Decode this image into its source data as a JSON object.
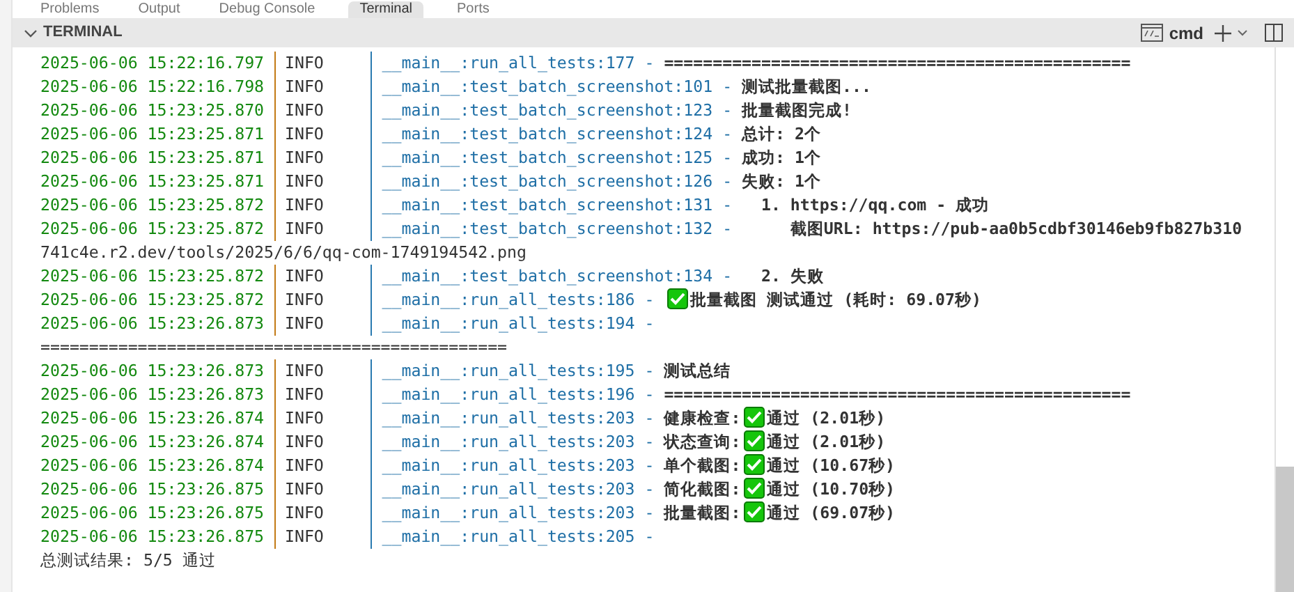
{
  "panel_tabs": [
    {
      "label": "Problems",
      "selected": false
    },
    {
      "label": "Output",
      "selected": false
    },
    {
      "label": "Debug Console",
      "selected": false
    },
    {
      "label": "Terminal",
      "selected": true
    },
    {
      "label": "Ports",
      "selected": false
    }
  ],
  "terminal": {
    "title": "TERMINAL",
    "shell": "cmd",
    "lines": [
      {
        "kind": "log",
        "time": "2025-06-06 15:22:16.797",
        "level": "INFO",
        "source": "__main__:run_all_tests:177 -",
        "segments": [
          {
            "kind": "text",
            "text": "================================================"
          }
        ]
      },
      {
        "kind": "log",
        "time": "2025-06-06 15:22:16.798",
        "level": "INFO",
        "source": "__main__:test_batch_screenshot:101 -",
        "segments": [
          {
            "kind": "text",
            "text": "测试批量截图..."
          }
        ]
      },
      {
        "kind": "log",
        "time": "2025-06-06 15:23:25.870",
        "level": "INFO",
        "source": "__main__:test_batch_screenshot:123 -",
        "segments": [
          {
            "kind": "text",
            "text": "批量截图完成!"
          }
        ]
      },
      {
        "kind": "log",
        "time": "2025-06-06 15:23:25.871",
        "level": "INFO",
        "source": "__main__:test_batch_screenshot:124 -",
        "segments": [
          {
            "kind": "text",
            "text": "总计: 2个"
          }
        ]
      },
      {
        "kind": "log",
        "time": "2025-06-06 15:23:25.871",
        "level": "INFO",
        "source": "__main__:test_batch_screenshot:125 -",
        "segments": [
          {
            "kind": "text",
            "text": "成功: 1个"
          }
        ]
      },
      {
        "kind": "log",
        "time": "2025-06-06 15:23:25.871",
        "level": "INFO",
        "source": "__main__:test_batch_screenshot:126 -",
        "segments": [
          {
            "kind": "text",
            "text": "失败: 1个"
          }
        ]
      },
      {
        "kind": "log",
        "time": "2025-06-06 15:23:25.872",
        "level": "INFO",
        "source": "__main__:test_batch_screenshot:131 -",
        "segments": [
          {
            "kind": "text",
            "text": "  1. https://qq.com - 成功"
          }
        ]
      },
      {
        "kind": "log",
        "time": "2025-06-06 15:23:25.872",
        "level": "INFO",
        "source": "__main__:test_batch_screenshot:132 -",
        "segments": [
          {
            "kind": "text",
            "text": "     截图URL: https://pub-aa0b5cdbf30146eb9fb827b310"
          }
        ]
      },
      {
        "kind": "plain",
        "text": "741c4e.r2.dev/tools/2025/6/6/qq-com-1749194542.png"
      },
      {
        "kind": "log",
        "time": "2025-06-06 15:23:25.872",
        "level": "INFO",
        "source": "__main__:test_batch_screenshot:134 -",
        "segments": [
          {
            "kind": "text",
            "text": "  2. 失败"
          }
        ]
      },
      {
        "kind": "log",
        "time": "2025-06-06 15:23:25.872",
        "level": "INFO",
        "source": "__main__:run_all_tests:186 -",
        "segments": [
          {
            "kind": "check"
          },
          {
            "kind": "text",
            "text": "批量截图 测试通过 (耗时: 69.07秒)"
          }
        ]
      },
      {
        "kind": "log",
        "time": "2025-06-06 15:23:26.873",
        "level": "INFO",
        "source": "__main__:run_all_tests:194 -"
      },
      {
        "kind": "plain",
        "text": "================================================"
      },
      {
        "kind": "log",
        "time": "2025-06-06 15:23:26.873",
        "level": "INFO",
        "source": "__main__:run_all_tests:195 -",
        "segments": [
          {
            "kind": "text",
            "text": "测试总结"
          }
        ]
      },
      {
        "kind": "log",
        "time": "2025-06-06 15:23:26.873",
        "level": "INFO",
        "source": "__main__:run_all_tests:196 -",
        "segments": [
          {
            "kind": "text",
            "text": "================================================"
          }
        ]
      },
      {
        "kind": "log",
        "time": "2025-06-06 15:23:26.874",
        "level": "INFO",
        "source": "__main__:run_all_tests:203 -",
        "segments": [
          {
            "kind": "text",
            "text": "健康检查:"
          },
          {
            "kind": "check"
          },
          {
            "kind": "text",
            "text": "通过 (2.01秒)"
          }
        ]
      },
      {
        "kind": "log",
        "time": "2025-06-06 15:23:26.874",
        "level": "INFO",
        "source": "__main__:run_all_tests:203 -",
        "segments": [
          {
            "kind": "text",
            "text": "状态查询:"
          },
          {
            "kind": "check"
          },
          {
            "kind": "text",
            "text": "通过 (2.01秒)"
          }
        ]
      },
      {
        "kind": "log",
        "time": "2025-06-06 15:23:26.874",
        "level": "INFO",
        "source": "__main__:run_all_tests:203 -",
        "segments": [
          {
            "kind": "text",
            "text": "单个截图:"
          },
          {
            "kind": "check"
          },
          {
            "kind": "text",
            "text": "通过 (10.67秒)"
          }
        ]
      },
      {
        "kind": "log",
        "time": "2025-06-06 15:23:26.875",
        "level": "INFO",
        "source": "__main__:run_all_tests:203 -",
        "segments": [
          {
            "kind": "text",
            "text": "简化截图:"
          },
          {
            "kind": "check"
          },
          {
            "kind": "text",
            "text": "通过 (10.70秒)"
          }
        ]
      },
      {
        "kind": "log",
        "time": "2025-06-06 15:23:26.875",
        "level": "INFO",
        "source": "__main__:run_all_tests:203 -",
        "segments": [
          {
            "kind": "text",
            "text": "批量截图:"
          },
          {
            "kind": "check"
          },
          {
            "kind": "text",
            "text": "通过 (69.07秒)"
          }
        ]
      },
      {
        "kind": "log",
        "time": "2025-06-06 15:23:26.875",
        "level": "INFO",
        "source": "__main__:run_all_tests:205 -"
      },
      {
        "kind": "plain",
        "text": "总测试结果: 5/5 通过"
      }
    ]
  }
}
